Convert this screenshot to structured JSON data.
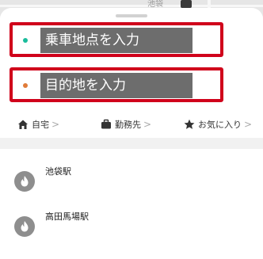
{
  "map": {
    "label": "池袋"
  },
  "inputs": {
    "pickup": {
      "placeholder": "乗車地点を入力",
      "dot_color": "#1abc9c"
    },
    "destination": {
      "placeholder": "目的地を入力",
      "dot_color": "#e07b39"
    },
    "highlight_color": "#d0021b"
  },
  "shortcuts": [
    {
      "label": "自宅",
      "icon": "home-icon"
    },
    {
      "label": "勤務先",
      "icon": "briefcase-icon"
    },
    {
      "label": "お気に入り",
      "icon": "star-icon"
    }
  ],
  "shortcut_chevron": ">",
  "stations": [
    {
      "name": "池袋駅",
      "icon": "flame-icon"
    },
    {
      "name": "高田馬場駅",
      "icon": "flame-icon"
    }
  ]
}
